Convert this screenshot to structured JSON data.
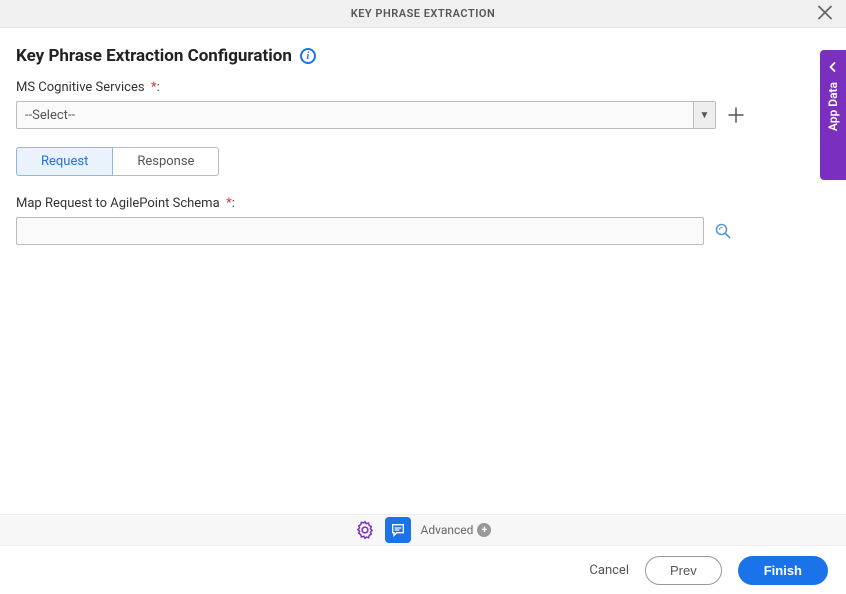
{
  "header": {
    "title": "KEY PHRASE EXTRACTION"
  },
  "page": {
    "title": "Key Phrase Extraction Configuration"
  },
  "fields": {
    "msCognitive": {
      "label": "MS Cognitive Services",
      "required_mark": "*",
      "selected": "--Select--"
    },
    "mapRequest": {
      "label": "Map Request to AgilePoint Schema",
      "required_mark": "*",
      "value": ""
    }
  },
  "tabs": {
    "request": "Request",
    "response": "Response"
  },
  "sidebar": {
    "appData": "App Data"
  },
  "footer": {
    "advanced": "Advanced",
    "cancel": "Cancel",
    "prev": "Prev",
    "finish": "Finish"
  }
}
